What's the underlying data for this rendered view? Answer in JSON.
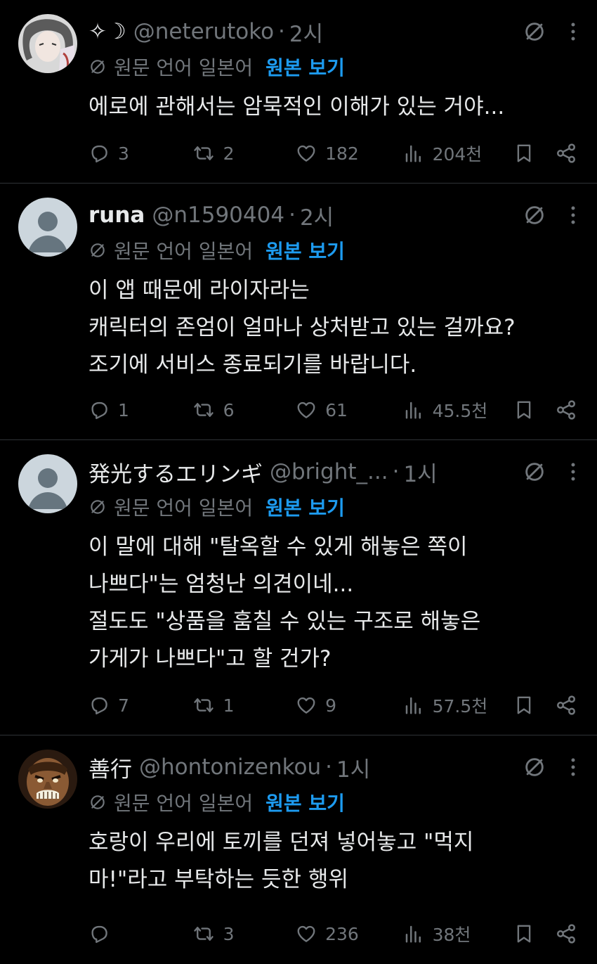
{
  "colors": {
    "background": "#000000",
    "text": "#e7e9ea",
    "muted": "#71767b",
    "link": "#1d9bf0",
    "divider": "#2f3336"
  },
  "tweets": [
    {
      "name": "✧☽",
      "handle": "@neterutoko",
      "dot": "·",
      "time": "2시",
      "translation_note": "원문 언어 일본어",
      "view_original": "원본 보기",
      "text": "에로에 관해서는 암묵적인 이해가 있는 거야...",
      "replies": "3",
      "retweets": "2",
      "likes": "182",
      "views": "204천",
      "avatar": "anime-avatar"
    },
    {
      "name": "runa",
      "handle": "@n1590404",
      "dot": "·",
      "time": "2시",
      "translation_note": "원문 언어 일본어",
      "view_original": "원본 보기",
      "text": "이 앱 때문에 라이자라는\n캐릭터의 존엄이 얼마나 상처받고 있는 걸까요?\n조기에 서비스 종료되기를 바랍니다.",
      "replies": "1",
      "retweets": "6",
      "likes": "61",
      "views": "45.5천",
      "avatar": "default-avatar"
    },
    {
      "name": "発光するエリンギ",
      "handle": "@bright_...",
      "dot": "·",
      "time": "1시",
      "translation_note": "원문 언어 일본어",
      "view_original": "원본 보기",
      "text": "이 말에 대해 \"탈옥할 수 있게 해놓은 쪽이\n나쁘다\"는 엄청난 의견이네...\n절도도 \"상품을 훔칠 수 있는 구조로 해놓은\n가게가 나쁘다\"고 할 건가?",
      "replies": "7",
      "retweets": "1",
      "likes": "9",
      "views": "57.5천",
      "avatar": "default-avatar"
    },
    {
      "name": "善行",
      "handle": "@hontonizenkou",
      "dot": "·",
      "time": "1시",
      "translation_note": "원문 언어 일본어",
      "view_original": "원본 보기",
      "text": "호랑이 우리에 토끼를 던져 넣어놓고 \"먹지\n마!\"라고 부탁하는 듯한 행위",
      "replies": "",
      "retweets": "3",
      "likes": "236",
      "views": "38천",
      "avatar": "face-avatar"
    }
  ]
}
